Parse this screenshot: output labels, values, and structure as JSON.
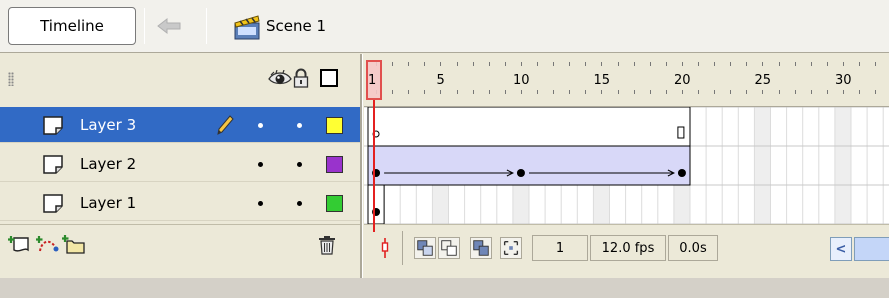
{
  "topbar": {
    "timeline_label": "Timeline",
    "back_icon": "left-arrow-icon",
    "scene_icon": "clapperboard-icon",
    "scene_label": "Scene 1"
  },
  "layer_header": {
    "icons": [
      "grip-icon",
      "eye-icon",
      "lock-icon",
      "outline-icon"
    ]
  },
  "layers": [
    {
      "name": "Layer 3",
      "selected": true,
      "editing": true,
      "color": "#ffff33"
    },
    {
      "name": "Layer 2",
      "selected": false,
      "editing": false,
      "color": "#9933cc"
    },
    {
      "name": "Layer 1",
      "selected": false,
      "editing": false,
      "color": "#33cc33"
    }
  ],
  "layer_footer": {
    "icons": [
      "insert-layer-icon",
      "add-motion-guide-icon",
      "insert-folder-icon",
      "trash-icon"
    ]
  },
  "ruler": {
    "labels": [
      "1",
      "5",
      "10",
      "15",
      "20",
      "25",
      "30"
    ],
    "current_frame_label": "1"
  },
  "frames_footer": {
    "buttons": [
      "center-frame-icon",
      "onion-skin-icon",
      "onion-skin-outlines-icon",
      "edit-multiple-frames-icon",
      "modify-onion-markers-icon"
    ],
    "current_frame": "1",
    "frame_rate": "12.0 fps",
    "elapsed_time": "0.0s"
  }
}
